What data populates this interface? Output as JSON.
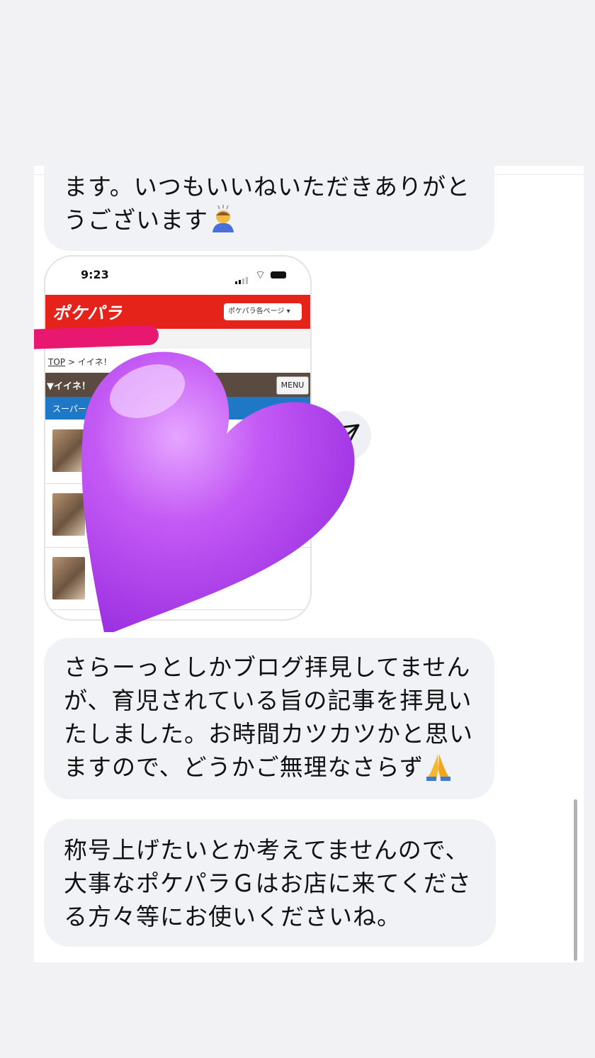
{
  "messages": {
    "first": "ます。いつもいいねいただきありがと\nうございます",
    "second": "さらーっとしかブログ拝見してません\nが、育児されている旨の記事を拝見い\nたしました。お時間カツカツかと思い\nますので、どうかご無理なさらず",
    "third": "称号上げたいとか考えてませんので、\n大事なポケパラＧはお店に来てくださ\nる方々等にお使いくださいね。"
  },
  "screenshot": {
    "time": "9:23",
    "logo": "ポケパラ",
    "select_label": "ポケパラ各ページ ▾",
    "breadcrumb_top": "TOP",
    "breadcrumb_sep": " > イイネ！",
    "category_title": "▼イイネ！",
    "menu_label": "MENU",
    "sub_title": "スーパー"
  },
  "icons": {
    "bow": "person-bowing-emoji",
    "pray": "folded-hands-emoji",
    "send": "send-paper-plane-icon",
    "heart": "purple-heart-sticker"
  },
  "colors": {
    "bubble": "#f1f2f5",
    "brand_red": "#e5231b",
    "heart": "#b445ee",
    "scribble": "#e8176f"
  }
}
